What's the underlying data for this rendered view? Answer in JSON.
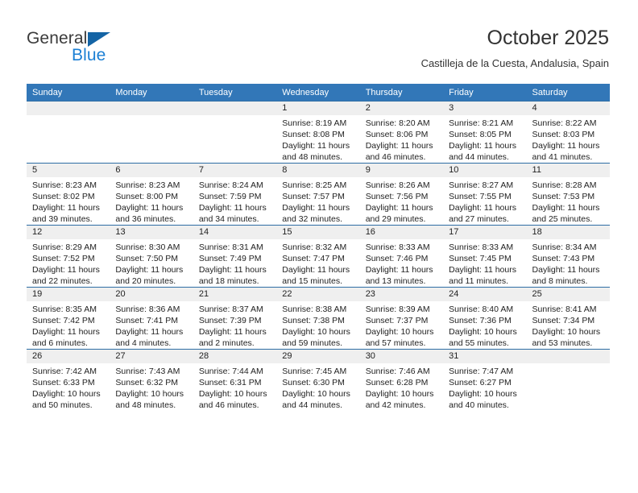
{
  "brand": {
    "name_part1": "General",
    "name_part2": "Blue",
    "accent_color": "#1464a5",
    "blue_text_color": "#1b7fd4"
  },
  "header": {
    "title": "October 2025",
    "subtitle": "Castilleja de la Cuesta, Andalusia, Spain"
  },
  "calendar": {
    "header_bg": "#3277b8",
    "row_border_color": "#2e6da4",
    "daynum_band_bg": "#efefef",
    "weekday_headers": [
      "Sunday",
      "Monday",
      "Tuesday",
      "Wednesday",
      "Thursday",
      "Friday",
      "Saturday"
    ],
    "weeks": [
      [
        {
          "day": "",
          "sunrise": "",
          "sunset": "",
          "daylight_line1": "",
          "daylight_line2": ""
        },
        {
          "day": "",
          "sunrise": "",
          "sunset": "",
          "daylight_line1": "",
          "daylight_line2": ""
        },
        {
          "day": "",
          "sunrise": "",
          "sunset": "",
          "daylight_line1": "",
          "daylight_line2": ""
        },
        {
          "day": "1",
          "sunrise": "Sunrise: 8:19 AM",
          "sunset": "Sunset: 8:08 PM",
          "daylight_line1": "Daylight: 11 hours",
          "daylight_line2": "and 48 minutes."
        },
        {
          "day": "2",
          "sunrise": "Sunrise: 8:20 AM",
          "sunset": "Sunset: 8:06 PM",
          "daylight_line1": "Daylight: 11 hours",
          "daylight_line2": "and 46 minutes."
        },
        {
          "day": "3",
          "sunrise": "Sunrise: 8:21 AM",
          "sunset": "Sunset: 8:05 PM",
          "daylight_line1": "Daylight: 11 hours",
          "daylight_line2": "and 44 minutes."
        },
        {
          "day": "4",
          "sunrise": "Sunrise: 8:22 AM",
          "sunset": "Sunset: 8:03 PM",
          "daylight_line1": "Daylight: 11 hours",
          "daylight_line2": "and 41 minutes."
        }
      ],
      [
        {
          "day": "5",
          "sunrise": "Sunrise: 8:23 AM",
          "sunset": "Sunset: 8:02 PM",
          "daylight_line1": "Daylight: 11 hours",
          "daylight_line2": "and 39 minutes."
        },
        {
          "day": "6",
          "sunrise": "Sunrise: 8:23 AM",
          "sunset": "Sunset: 8:00 PM",
          "daylight_line1": "Daylight: 11 hours",
          "daylight_line2": "and 36 minutes."
        },
        {
          "day": "7",
          "sunrise": "Sunrise: 8:24 AM",
          "sunset": "Sunset: 7:59 PM",
          "daylight_line1": "Daylight: 11 hours",
          "daylight_line2": "and 34 minutes."
        },
        {
          "day": "8",
          "sunrise": "Sunrise: 8:25 AM",
          "sunset": "Sunset: 7:57 PM",
          "daylight_line1": "Daylight: 11 hours",
          "daylight_line2": "and 32 minutes."
        },
        {
          "day": "9",
          "sunrise": "Sunrise: 8:26 AM",
          "sunset": "Sunset: 7:56 PM",
          "daylight_line1": "Daylight: 11 hours",
          "daylight_line2": "and 29 minutes."
        },
        {
          "day": "10",
          "sunrise": "Sunrise: 8:27 AM",
          "sunset": "Sunset: 7:55 PM",
          "daylight_line1": "Daylight: 11 hours",
          "daylight_line2": "and 27 minutes."
        },
        {
          "day": "11",
          "sunrise": "Sunrise: 8:28 AM",
          "sunset": "Sunset: 7:53 PM",
          "daylight_line1": "Daylight: 11 hours",
          "daylight_line2": "and 25 minutes."
        }
      ],
      [
        {
          "day": "12",
          "sunrise": "Sunrise: 8:29 AM",
          "sunset": "Sunset: 7:52 PM",
          "daylight_line1": "Daylight: 11 hours",
          "daylight_line2": "and 22 minutes."
        },
        {
          "day": "13",
          "sunrise": "Sunrise: 8:30 AM",
          "sunset": "Sunset: 7:50 PM",
          "daylight_line1": "Daylight: 11 hours",
          "daylight_line2": "and 20 minutes."
        },
        {
          "day": "14",
          "sunrise": "Sunrise: 8:31 AM",
          "sunset": "Sunset: 7:49 PM",
          "daylight_line1": "Daylight: 11 hours",
          "daylight_line2": "and 18 minutes."
        },
        {
          "day": "15",
          "sunrise": "Sunrise: 8:32 AM",
          "sunset": "Sunset: 7:47 PM",
          "daylight_line1": "Daylight: 11 hours",
          "daylight_line2": "and 15 minutes."
        },
        {
          "day": "16",
          "sunrise": "Sunrise: 8:33 AM",
          "sunset": "Sunset: 7:46 PM",
          "daylight_line1": "Daylight: 11 hours",
          "daylight_line2": "and 13 minutes."
        },
        {
          "day": "17",
          "sunrise": "Sunrise: 8:33 AM",
          "sunset": "Sunset: 7:45 PM",
          "daylight_line1": "Daylight: 11 hours",
          "daylight_line2": "and 11 minutes."
        },
        {
          "day": "18",
          "sunrise": "Sunrise: 8:34 AM",
          "sunset": "Sunset: 7:43 PM",
          "daylight_line1": "Daylight: 11 hours",
          "daylight_line2": "and 8 minutes."
        }
      ],
      [
        {
          "day": "19",
          "sunrise": "Sunrise: 8:35 AM",
          "sunset": "Sunset: 7:42 PM",
          "daylight_line1": "Daylight: 11 hours",
          "daylight_line2": "and 6 minutes."
        },
        {
          "day": "20",
          "sunrise": "Sunrise: 8:36 AM",
          "sunset": "Sunset: 7:41 PM",
          "daylight_line1": "Daylight: 11 hours",
          "daylight_line2": "and 4 minutes."
        },
        {
          "day": "21",
          "sunrise": "Sunrise: 8:37 AM",
          "sunset": "Sunset: 7:39 PM",
          "daylight_line1": "Daylight: 11 hours",
          "daylight_line2": "and 2 minutes."
        },
        {
          "day": "22",
          "sunrise": "Sunrise: 8:38 AM",
          "sunset": "Sunset: 7:38 PM",
          "daylight_line1": "Daylight: 10 hours",
          "daylight_line2": "and 59 minutes."
        },
        {
          "day": "23",
          "sunrise": "Sunrise: 8:39 AM",
          "sunset": "Sunset: 7:37 PM",
          "daylight_line1": "Daylight: 10 hours",
          "daylight_line2": "and 57 minutes."
        },
        {
          "day": "24",
          "sunrise": "Sunrise: 8:40 AM",
          "sunset": "Sunset: 7:36 PM",
          "daylight_line1": "Daylight: 10 hours",
          "daylight_line2": "and 55 minutes."
        },
        {
          "day": "25",
          "sunrise": "Sunrise: 8:41 AM",
          "sunset": "Sunset: 7:34 PM",
          "daylight_line1": "Daylight: 10 hours",
          "daylight_line2": "and 53 minutes."
        }
      ],
      [
        {
          "day": "26",
          "sunrise": "Sunrise: 7:42 AM",
          "sunset": "Sunset: 6:33 PM",
          "daylight_line1": "Daylight: 10 hours",
          "daylight_line2": "and 50 minutes."
        },
        {
          "day": "27",
          "sunrise": "Sunrise: 7:43 AM",
          "sunset": "Sunset: 6:32 PM",
          "daylight_line1": "Daylight: 10 hours",
          "daylight_line2": "and 48 minutes."
        },
        {
          "day": "28",
          "sunrise": "Sunrise: 7:44 AM",
          "sunset": "Sunset: 6:31 PM",
          "daylight_line1": "Daylight: 10 hours",
          "daylight_line2": "and 46 minutes."
        },
        {
          "day": "29",
          "sunrise": "Sunrise: 7:45 AM",
          "sunset": "Sunset: 6:30 PM",
          "daylight_line1": "Daylight: 10 hours",
          "daylight_line2": "and 44 minutes."
        },
        {
          "day": "30",
          "sunrise": "Sunrise: 7:46 AM",
          "sunset": "Sunset: 6:28 PM",
          "daylight_line1": "Daylight: 10 hours",
          "daylight_line2": "and 42 minutes."
        },
        {
          "day": "31",
          "sunrise": "Sunrise: 7:47 AM",
          "sunset": "Sunset: 6:27 PM",
          "daylight_line1": "Daylight: 10 hours",
          "daylight_line2": "and 40 minutes."
        },
        {
          "day": "",
          "sunrise": "",
          "sunset": "",
          "daylight_line1": "",
          "daylight_line2": ""
        }
      ]
    ]
  }
}
